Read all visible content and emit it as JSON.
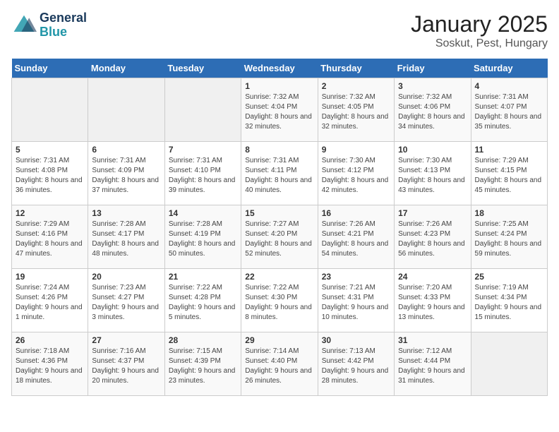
{
  "header": {
    "logo_line1": "General",
    "logo_line2": "Blue",
    "title": "January 2025",
    "subtitle": "Soskut, Pest, Hungary"
  },
  "days_of_week": [
    "Sunday",
    "Monday",
    "Tuesday",
    "Wednesday",
    "Thursday",
    "Friday",
    "Saturday"
  ],
  "weeks": [
    [
      {
        "day": "",
        "info": ""
      },
      {
        "day": "",
        "info": ""
      },
      {
        "day": "",
        "info": ""
      },
      {
        "day": "1",
        "info": "Sunrise: 7:32 AM\nSunset: 4:04 PM\nDaylight: 8 hours and 32 minutes."
      },
      {
        "day": "2",
        "info": "Sunrise: 7:32 AM\nSunset: 4:05 PM\nDaylight: 8 hours and 32 minutes."
      },
      {
        "day": "3",
        "info": "Sunrise: 7:32 AM\nSunset: 4:06 PM\nDaylight: 8 hours and 34 minutes."
      },
      {
        "day": "4",
        "info": "Sunrise: 7:31 AM\nSunset: 4:07 PM\nDaylight: 8 hours and 35 minutes."
      }
    ],
    [
      {
        "day": "5",
        "info": "Sunrise: 7:31 AM\nSunset: 4:08 PM\nDaylight: 8 hours and 36 minutes."
      },
      {
        "day": "6",
        "info": "Sunrise: 7:31 AM\nSunset: 4:09 PM\nDaylight: 8 hours and 37 minutes."
      },
      {
        "day": "7",
        "info": "Sunrise: 7:31 AM\nSunset: 4:10 PM\nDaylight: 8 hours and 39 minutes."
      },
      {
        "day": "8",
        "info": "Sunrise: 7:31 AM\nSunset: 4:11 PM\nDaylight: 8 hours and 40 minutes."
      },
      {
        "day": "9",
        "info": "Sunrise: 7:30 AM\nSunset: 4:12 PM\nDaylight: 8 hours and 42 minutes."
      },
      {
        "day": "10",
        "info": "Sunrise: 7:30 AM\nSunset: 4:13 PM\nDaylight: 8 hours and 43 minutes."
      },
      {
        "day": "11",
        "info": "Sunrise: 7:29 AM\nSunset: 4:15 PM\nDaylight: 8 hours and 45 minutes."
      }
    ],
    [
      {
        "day": "12",
        "info": "Sunrise: 7:29 AM\nSunset: 4:16 PM\nDaylight: 8 hours and 47 minutes."
      },
      {
        "day": "13",
        "info": "Sunrise: 7:28 AM\nSunset: 4:17 PM\nDaylight: 8 hours and 48 minutes."
      },
      {
        "day": "14",
        "info": "Sunrise: 7:28 AM\nSunset: 4:19 PM\nDaylight: 8 hours and 50 minutes."
      },
      {
        "day": "15",
        "info": "Sunrise: 7:27 AM\nSunset: 4:20 PM\nDaylight: 8 hours and 52 minutes."
      },
      {
        "day": "16",
        "info": "Sunrise: 7:26 AM\nSunset: 4:21 PM\nDaylight: 8 hours and 54 minutes."
      },
      {
        "day": "17",
        "info": "Sunrise: 7:26 AM\nSunset: 4:23 PM\nDaylight: 8 hours and 56 minutes."
      },
      {
        "day": "18",
        "info": "Sunrise: 7:25 AM\nSunset: 4:24 PM\nDaylight: 8 hours and 59 minutes."
      }
    ],
    [
      {
        "day": "19",
        "info": "Sunrise: 7:24 AM\nSunset: 4:26 PM\nDaylight: 9 hours and 1 minute."
      },
      {
        "day": "20",
        "info": "Sunrise: 7:23 AM\nSunset: 4:27 PM\nDaylight: 9 hours and 3 minutes."
      },
      {
        "day": "21",
        "info": "Sunrise: 7:22 AM\nSunset: 4:28 PM\nDaylight: 9 hours and 5 minutes."
      },
      {
        "day": "22",
        "info": "Sunrise: 7:22 AM\nSunset: 4:30 PM\nDaylight: 9 hours and 8 minutes."
      },
      {
        "day": "23",
        "info": "Sunrise: 7:21 AM\nSunset: 4:31 PM\nDaylight: 9 hours and 10 minutes."
      },
      {
        "day": "24",
        "info": "Sunrise: 7:20 AM\nSunset: 4:33 PM\nDaylight: 9 hours and 13 minutes."
      },
      {
        "day": "25",
        "info": "Sunrise: 7:19 AM\nSunset: 4:34 PM\nDaylight: 9 hours and 15 minutes."
      }
    ],
    [
      {
        "day": "26",
        "info": "Sunrise: 7:18 AM\nSunset: 4:36 PM\nDaylight: 9 hours and 18 minutes."
      },
      {
        "day": "27",
        "info": "Sunrise: 7:16 AM\nSunset: 4:37 PM\nDaylight: 9 hours and 20 minutes."
      },
      {
        "day": "28",
        "info": "Sunrise: 7:15 AM\nSunset: 4:39 PM\nDaylight: 9 hours and 23 minutes."
      },
      {
        "day": "29",
        "info": "Sunrise: 7:14 AM\nSunset: 4:40 PM\nDaylight: 9 hours and 26 minutes."
      },
      {
        "day": "30",
        "info": "Sunrise: 7:13 AM\nSunset: 4:42 PM\nDaylight: 9 hours and 28 minutes."
      },
      {
        "day": "31",
        "info": "Sunrise: 7:12 AM\nSunset: 4:44 PM\nDaylight: 9 hours and 31 minutes."
      },
      {
        "day": "",
        "info": ""
      }
    ]
  ]
}
